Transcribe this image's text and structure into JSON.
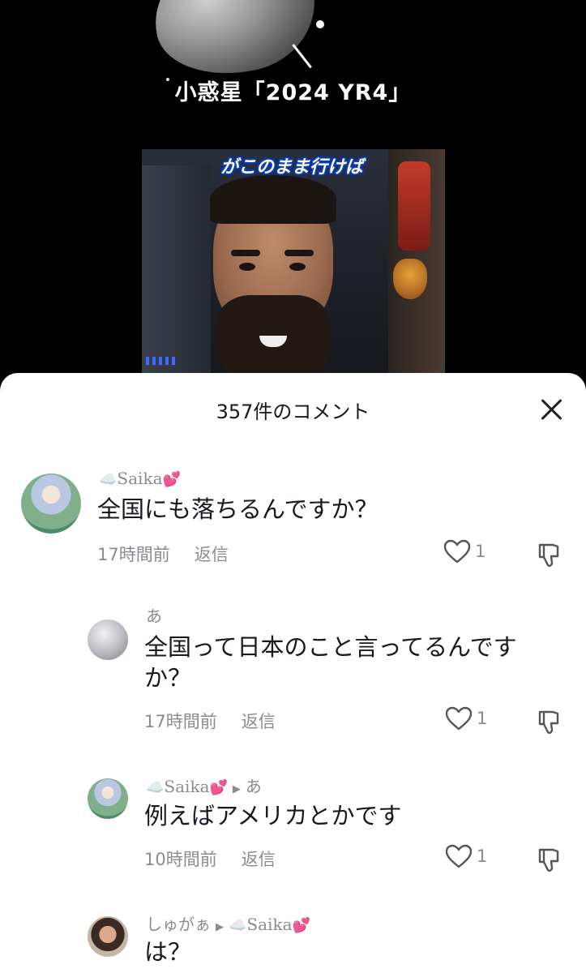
{
  "video": {
    "title": "小惑星「2024 YR4」",
    "caption": "がこのまま行けば"
  },
  "comments_sheet": {
    "title": "357件のコメント",
    "comments": [
      {
        "username": "Saika",
        "text": "全国にも落ちるんですか？",
        "time": "17時間前",
        "reply_label": "返信",
        "likes": "1"
      },
      {
        "username": "あ",
        "text_line1": "全国って日本のこと言ってるんです",
        "text_line2": "か？",
        "time": "17時間前",
        "reply_label": "返信",
        "likes": "1"
      },
      {
        "username": "Saika",
        "reply_to": "あ",
        "text": "例えばアメリカとかです",
        "time": "10時間前",
        "reply_label": "返信",
        "likes": "1"
      },
      {
        "username": "しゅがぁ",
        "reply_to": "Saika",
        "text": "は？"
      }
    ]
  },
  "colors": {
    "sheet_bg": "#ffffff",
    "secondary_text": "#8a8b91",
    "heart_emoji": "#f06fb4"
  },
  "icons": [
    "close-icon",
    "heart-outline-icon",
    "dislike-icon",
    "cloud-emoji",
    "pink-hearts-emoji",
    "reply-arrow-icon"
  ]
}
